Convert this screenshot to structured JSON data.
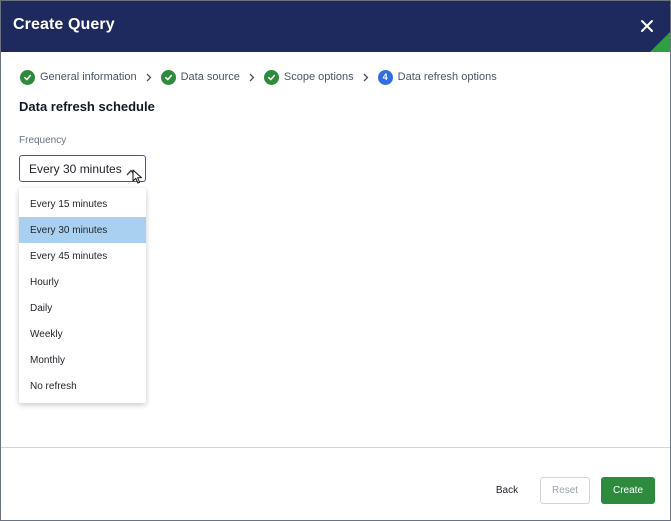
{
  "dialog": {
    "title": "Create Query"
  },
  "stepper": {
    "steps": [
      {
        "label": "General information",
        "status": "complete"
      },
      {
        "label": "Data source",
        "status": "complete"
      },
      {
        "label": "Scope options",
        "status": "complete"
      },
      {
        "label": "Data refresh options",
        "status": "current",
        "number": "4"
      }
    ]
  },
  "section": {
    "title": "Data refresh schedule"
  },
  "frequency": {
    "label": "Frequency",
    "value": "Every 30 minutes",
    "options": [
      "Every 15 minutes",
      "Every 30 minutes",
      "Every 45 minutes",
      "Hourly",
      "Daily",
      "Weekly",
      "Monthly",
      "No refresh"
    ],
    "selected_index": 1
  },
  "footer": {
    "back_label": "Back",
    "reset_label": "Reset",
    "create_label": "Create"
  },
  "colors": {
    "header_bg": "#1e2a5e",
    "accent_green": "#2e8b3e",
    "step_current": "#2f6de1",
    "option_selected": "#a9d0f0"
  },
  "icons": [
    "close-icon",
    "check-circle-icon",
    "chevron-right-icon",
    "chevron-up-icon",
    "mouse-cursor-icon"
  ]
}
